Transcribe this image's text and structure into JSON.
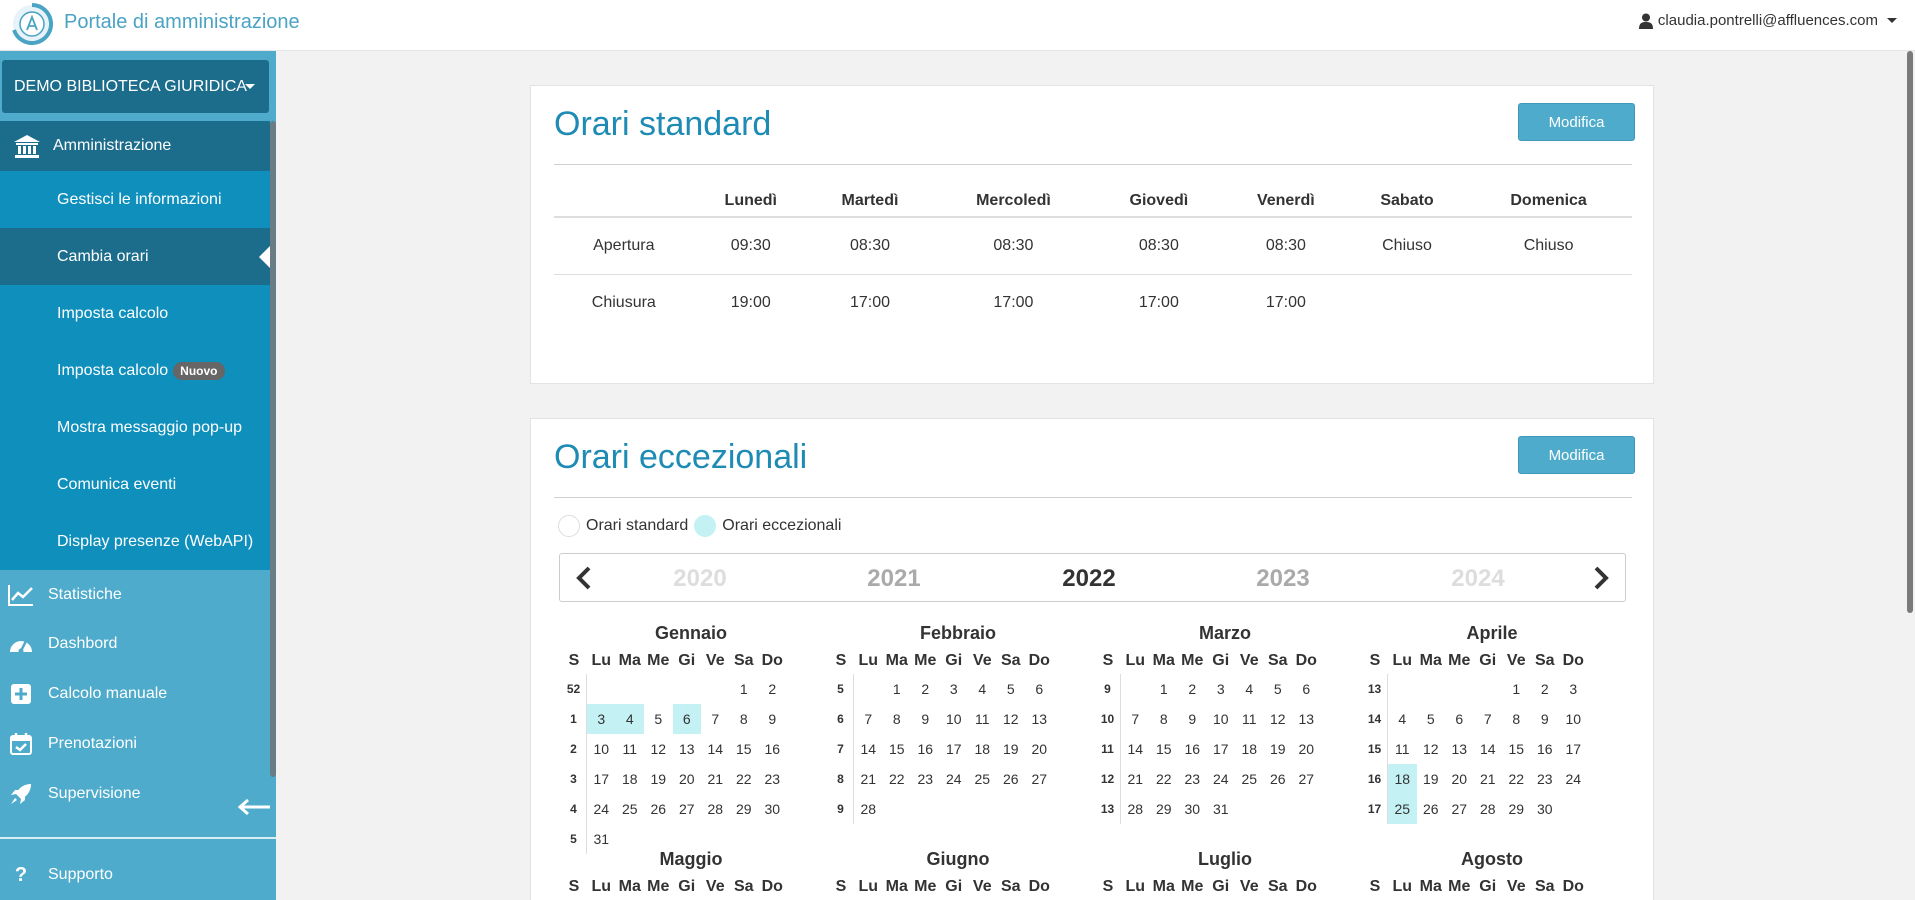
{
  "header": {
    "title": "Portale di amministrazione",
    "user": "claudia.pontrelli@affluences.com"
  },
  "sidebar": {
    "organization": "DEMO BIBLIOTECA GIURIDICA",
    "section": "Amministrazione",
    "sub_items": [
      {
        "label": "Gestisci le informazioni"
      },
      {
        "label": "Cambia orari",
        "active": true
      },
      {
        "label": "Imposta calcolo"
      },
      {
        "label": "Imposta calcolo",
        "badge": "Nuovo"
      },
      {
        "label": "Mostra messaggio pop-up"
      },
      {
        "label": "Comunica eventi"
      },
      {
        "label": "Display presenze (WebAPI)"
      }
    ],
    "nav_items": [
      {
        "label": "Statistiche",
        "icon": "chart-line-icon"
      },
      {
        "label": "Dashbord",
        "icon": "dashboard-icon"
      },
      {
        "label": "Calcolo manuale",
        "icon": "plus-square-icon"
      },
      {
        "label": "Prenotazioni",
        "icon": "calendar-check-icon"
      },
      {
        "label": "Supervisione",
        "icon": "rocket-icon"
      }
    ],
    "support": "Supporto"
  },
  "standard_hours": {
    "title": "Orari standard",
    "edit_label": "Modifica",
    "days": [
      "Lunedì",
      "Martedì",
      "Mercoledì",
      "Giovedì",
      "Venerdì",
      "Sabato",
      "Domenica"
    ],
    "rows": [
      {
        "label": "Apertura",
        "values": [
          "09:30",
          "08:30",
          "08:30",
          "08:30",
          "08:30",
          "Chiuso",
          "Chiuso"
        ]
      },
      {
        "label": "Chiusura",
        "values": [
          "19:00",
          "17:00",
          "17:00",
          "17:00",
          "17:00",
          "",
          ""
        ]
      }
    ]
  },
  "exceptional_hours": {
    "title": "Orari eccezionali",
    "edit_label": "Modifica",
    "legend": {
      "standard": "Orari standard",
      "exceptional": "Orari eccezionali"
    },
    "highlight_color": "#c4f1f4",
    "years": [
      "2020",
      "2021",
      "2022",
      "2023",
      "2024"
    ],
    "selected_year": "2022",
    "weekday_headers": [
      "S",
      "Lu",
      "Ma",
      "Me",
      "Gi",
      "Ve",
      "Sa",
      "Do"
    ],
    "months": [
      {
        "name": "Gennaio",
        "weeks": [
          {
            "w": "52",
            "days": [
              "",
              "",
              "",
              "",
              "",
              "1",
              "2"
            ]
          },
          {
            "w": "1",
            "days": [
              "3",
              "4",
              "5",
              "6",
              "7",
              "8",
              "9"
            ],
            "hl": [
              0,
              1,
              3
            ]
          },
          {
            "w": "2",
            "days": [
              "10",
              "11",
              "12",
              "13",
              "14",
              "15",
              "16"
            ]
          },
          {
            "w": "3",
            "days": [
              "17",
              "18",
              "19",
              "20",
              "21",
              "22",
              "23"
            ]
          },
          {
            "w": "4",
            "days": [
              "24",
              "25",
              "26",
              "27",
              "28",
              "29",
              "30"
            ]
          },
          {
            "w": "5",
            "days": [
              "31",
              "",
              "",
              "",
              "",
              "",
              ""
            ]
          }
        ]
      },
      {
        "name": "Febbraio",
        "weeks": [
          {
            "w": "5",
            "days": [
              "",
              "1",
              "2",
              "3",
              "4",
              "5",
              "6"
            ]
          },
          {
            "w": "6",
            "days": [
              "7",
              "8",
              "9",
              "10",
              "11",
              "12",
              "13"
            ]
          },
          {
            "w": "7",
            "days": [
              "14",
              "15",
              "16",
              "17",
              "18",
              "19",
              "20"
            ]
          },
          {
            "w": "8",
            "days": [
              "21",
              "22",
              "23",
              "24",
              "25",
              "26",
              "27"
            ]
          },
          {
            "w": "9",
            "days": [
              "28",
              "",
              "",
              "",
              "",
              "",
              ""
            ]
          }
        ]
      },
      {
        "name": "Marzo",
        "weeks": [
          {
            "w": "9",
            "days": [
              "",
              "1",
              "2",
              "3",
              "4",
              "5",
              "6"
            ]
          },
          {
            "w": "10",
            "days": [
              "7",
              "8",
              "9",
              "10",
              "11",
              "12",
              "13"
            ]
          },
          {
            "w": "11",
            "days": [
              "14",
              "15",
              "16",
              "17",
              "18",
              "19",
              "20"
            ]
          },
          {
            "w": "12",
            "days": [
              "21",
              "22",
              "23",
              "24",
              "25",
              "26",
              "27"
            ]
          },
          {
            "w": "13",
            "days": [
              "28",
              "29",
              "30",
              "31",
              "",
              "",
              ""
            ]
          }
        ]
      },
      {
        "name": "Aprile",
        "weeks": [
          {
            "w": "13",
            "days": [
              "",
              "",
              "",
              "",
              "1",
              "2",
              "3"
            ]
          },
          {
            "w": "14",
            "days": [
              "4",
              "5",
              "6",
              "7",
              "8",
              "9",
              "10"
            ]
          },
          {
            "w": "15",
            "days": [
              "11",
              "12",
              "13",
              "14",
              "15",
              "16",
              "17"
            ]
          },
          {
            "w": "16",
            "days": [
              "18",
              "19",
              "20",
              "21",
              "22",
              "23",
              "24"
            ],
            "hl": [
              0
            ]
          },
          {
            "w": "17",
            "days": [
              "25",
              "26",
              "27",
              "28",
              "29",
              "30",
              ""
            ],
            "hl": [
              0
            ]
          }
        ]
      },
      {
        "name": "Maggio",
        "weeks": []
      },
      {
        "name": "Giugno",
        "weeks": []
      },
      {
        "name": "Luglio",
        "weeks": []
      },
      {
        "name": "Agosto",
        "weeks": []
      }
    ]
  }
}
